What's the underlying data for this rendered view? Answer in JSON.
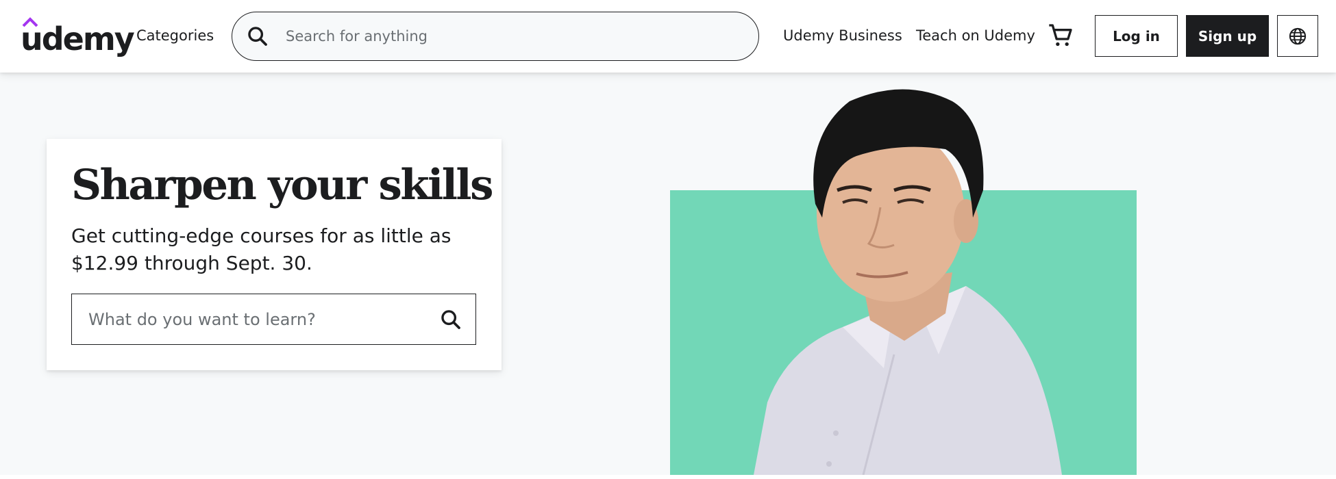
{
  "brand": {
    "logo_text": "udemy",
    "accent_color": "#a435f0",
    "text_color": "#1c1d1f"
  },
  "header": {
    "categories_label": "Categories",
    "search_placeholder": "Search for anything",
    "business_link": "Udemy Business",
    "teach_link": "Teach on Udemy",
    "cart_icon": "cart-icon",
    "login_label": "Log in",
    "signup_label": "Sign up",
    "language_icon": "globe-icon"
  },
  "hero": {
    "title": "Sharpen your skills",
    "subtitle": "Get cutting-edge courses for as little as $12.99 through Sept. 30.",
    "search_placeholder": "What do you want to learn?",
    "background_color": "#f7f9fa",
    "block_color": "#72d7b7"
  }
}
